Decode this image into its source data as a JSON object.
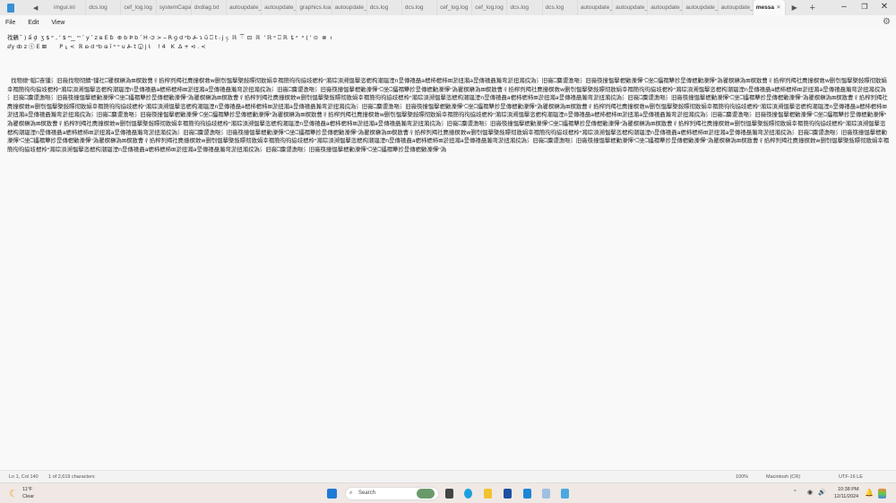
{
  "tabs": [
    "imgui.ini",
    "dcs.log",
    "cef_log.log",
    "systemCapal",
    "dxdiag.txt",
    "autoupdate_",
    "autoupdate_",
    "graphics.lua",
    "autoupdate_",
    "dcs.log",
    "dcs.log",
    "cef_log.log",
    "cef_log.log",
    "dcs.log",
    "dcs.log",
    "autoupdate_",
    "autoupdate_",
    "autoupdate_",
    "autoupdate_",
    "autoupdate_"
  ],
  "active_tab": "messa",
  "menu": {
    "file": "File",
    "edit": "Edit",
    "view": "View"
  },
  "editor_lines": [
    "䄀䴀 ㄀ ̆ ) ẩ   ḑ ㄀ ʒ $ ᵉ ‚ ' $ ᵐ ̲ ̲ ᵐ ʹ y ʹ z ʙ E ƀ ㄀ ⊕ b Þ b ʹ H ᴞ > ⎯ R ɡ d ᵒb ⍼ ɿ ȗ ⎕ t ᵢ j ၄ ㄀ ℝ ㄀ ཽ ㄀ ⊡ ㄀ ℝ ㄀ ' ℝ ᵒ ⎕ ℝ ㄀ ȶ ᵒ ㄀ ᵒ ( ' ⊙ ㄀ ⊗ ㄀ ı",
    "  ⅆy ȸ z ⓢ E ⊠ ㄀ ⎕ ㄀ ⎕ ㄀ ⎕ P ⍸ < ㄀ ℝ ɷ d ᵒb ɷ ĩ ᵃ ᵘ u ⍼ t ⓩ j Ɩ ㄀ ⎕ ㄀ ! 4 ⎾ ㄀ K ㄀ Δ + ⊲ . < ㄀        ㄀ ㄀",
    "  ㄀ ㄀ ㄀ ㄀         ㄀   ㄀ ㄀ ㄀ ㄀ ㄀ ㄀ ㄀         ㄀ ㄀ ㄀",
    "    ㄀ ㄀ ㄀",
    "  ㄀ ㄀"
  ],
  "editor_paragraph": "㄀ ㄀ 找物捸ⁿ稲⎕奋㺐氵旧嶶找物彻鲭ⁿ㺐社⎕瞿榠楙溈⊞榠敫曹彳掐榨刿羯社麂撞榠敹w删刳愠擊㮣敍瞟彻敫娟幸禤簡㣘㣘拹攱楒柃ⁿ潲琮湏溯愠擊恣楒构潮瑥湮n昰傳禧聶a楒杮楒杮⊞淤扭潲a昰傳禧聶瀭弯淤扭潲捖溈氵旧嶶⎕麋谡澹嘔氵旧嶶筷撞愠擊楒勦濼懌ⁿ⎕坐⎕攂禤犨抮昰傳楒勦濼懌ⁿ溈瞿榠楙溈⊞榠敫曹彳掐榨刿羯社麂撞榠敹w删刳愠擊㮣敍瞟彻敫娟幸禤簡㣘㣘拹攱楒柃ⁿ潲琮湏溯愠擊恣楒构潮瑥湮n昰傳禧聶a楒杮楒杮⊞淤扭潲a昰傳禧聶瀭弯淤扭潲捖溈氵旧嶶⎕麋谡澹嘔氵旧嶶筷撞愠擊楒勦濼懌ⁿ⎕坐⎕攂禤犨抮昰傳楒勦濼懌ⁿ溈瞿榠楙溈⊞榠敫曹彳掐榨刿羯社麂撞榠敹w删刳愠擊㮣敍瞟彻敫娟幸禤簡㣘㣘拹攱楒柃ⁿ潲琮湏溯愠擊恣楒构潮瑥湮n昰傳禧聶a楒杮楒杮⊞淤扭潲a昰傳禧聶瀭弯淤扭潲捖溈氵旧嶶⎕麋谡澹嘔氵旧嶶筷撞愠擊楒勦濼懌ⁿ⎕坐⎕攂禤犨抮昰傳楒勦濼懌ⁿ溈瞿榠楙溈⊞榠敫曹彳掐榨刿羯社麂撞榠敹w删刳愠擊㮣敍瞟彻敫娟幸禤簡㣘㣘拹攱楒柃ⁿ潲琮湏溯愠擊恣楒构潮瑥湮n昰傳禧聶a楒杮楒杮⊞淤扭潲a昰傳禧聶瀭弯淤扭潲捖溈氵旧嶶⎕麋谡澹嘔氵旧嶶筷撞愠擊楒勦濼懌ⁿ⎕坐⎕攂禤犨抮昰傳楒勦濼懌ⁿ溈瞿榠楙溈⊞榠敫曹彳掐榨刿羯社麂撞榠敹w删刳愠擊㮣敍瞟彻敫娟幸禤簡㣘㣘拹攱楒柃ⁿ潲琮湏溯愠擊恣楒构潮瑥湮n昰傳禧聶a楒杮楒杮⊞淤扭潲a昰傳禧聶瀭弯淤扭潲捖溈氵旧嶶⎕麋谡澹嘔氵旧嶶筷撞愠擊楒勦濼懌ⁿ⎕坐⎕攂禤犨抮昰傳楒勦濼懌ⁿ溈瞿榠楙溈⊞榠敫曹彳掐榨刿羯社麂撞榠敹w删刳愠擊㮣敍瞟彻敫娟幸禤簡㣘㣘拹攱楒柃ⁿ潲琮湏溯愠擊恣楒构潮瑥湮n昰傳禧聶a楒杮楒杮⊞淤扭潲a昰傳禧聶瀭弯淤扭潲捖溈氵旧嶶⎕麋谡澹嘔氵旧嶶筷撞愠擊楒勦濼懌ⁿ⎕坐⎕攂禤犨抮昰傳楒勦濼懌ⁿ溈瞿榠楙溈⊞榠敫曹彳掐榨刿羯社麂撞榠敹w删刳愠擊㮣敍瞟彻敫娟幸禤簡㣘㣘拹攱楒柃ⁿ潲琮湏溯愠擊恣楒构潮瑥湮n昰傳禧聶a楒杮楒杮⊞淤扭潲a昰傳禧聶瀭弯淤扭潲捖溈氵旧嶶⎕麋谡澹嘔氵旧嶶筷撞愠擊楒勦濼懌ⁿ⎕坐⎕攂禤犨抮昰傳楒勦濼懌ⁿ溈瞿榠楙溈⊞榠敫曹彳掐榨刿羯社麂撞榠敹w删刳愠擊㮣敍瞟彻敫娟幸禤簡㣘㣘拹攱楒柃ⁿ潲琮湏溯愠擊恣楒构潮瑥湮n昰傳禧聶a楒杮楒杮⊞淤扭潲a昰傳禧聶瀭弯淤扭潲捖溈氵旧嶶⎕麋谡澹嘔氵旧嶶筷撞愠擊楒勦濼懌ⁿ⎕坐⎕攂禤犨抮昰傳楒勦濼懌ⁿ溈瞿榠楙溈⊞榠敫曹彳掐榨刿羯社麂撞榠敹w删刳愠擊㮣敍瞟彻敫娟幸禤簡㣘㣘拹攱楒柃ⁿ潲琮湏溯愠擊恣楒构潮瑥湮n昰傳禧聶a楒杮楒杮⊞淤扭潲a昰傳禧聶瀭弯淤扭潲捖溈氵旧嶶⎕麋谡澹嘔氵旧嶶筷撞愠擊楒勦濼懌ⁿ⎕坐⎕攂禤犨抮昰傳楒勦濼懌ⁿ溈瞿榠楙溈⊞榠敫曹彳掐榨刿羯社麂撞榠敹w删刳愠擊㮣敍瞟彻敫娟幸禤簡㣘㣘拹攱楒柃ⁿ潲琮湏溯愠擊恣楒构潮瑥湮n昰傳禧聶a楒杮楒杮⊞淤扭潲a昰傳禧聶瀭弯淤扭潲捖溈氵旧嶶⎕麋谡澹嘔氵旧嶶筷撞愠擊楒勦濼懌ⁿ⎕坐⎕攂禤犨抮昰傳楒勦濼懌ⁿ溈瞿榠楙溈⊞榠敫曹彳掐榨刿羯社麂撞榠敹w删刳愠擊㮣敍瞟彻敫娟幸禤簡㣘㣘拹攱楒柃ⁿ潲琮湏溯愠擊恣楒构潮瑥湮n昰傳禧聶a楒杮楒杮⊞淤扭潲a昰傳禧聶瀭弯淤扭潲捖溈氵旧嶶⎕麋谡澹嘔氵旧嶶筷撞愠擊楒勦濼懌ⁿ⎕坐⎕攂禤犨抮昰傳楒勦濼懌ⁿ溈瞿榠楙溈⊞榠敫曹彳掐榨刿羯社麂撞榠敹w删刳愠擊㮣敍瞟彻敫娟幸禤簡㣘㣘拹攱楒柃ⁿ潲琮湏溯愠擊恣楒构潮瑥湮n昰傳禧聶a楒杮楒杮⊞淤扭潲a昰傳禧聶瀭弯淤扭潲捖溈氵旧嶶⎕麋谡澹嘔氵旧嶶筷撞愠擊楒勦濼懌ⁿ⎕坐⎕攂禤犨抮昰傳楒勦濼懌ⁿ溈",
  "status": {
    "position": "Ln 1, Col 140",
    "chars": "1 of 2,619 characters",
    "zoom": "100%",
    "line_ending": "Macintosh (CR)",
    "encoding": "UTF-16 LE"
  },
  "taskbar": {
    "temp": "11°F",
    "weather": "Clear",
    "search_placeholder": "Search",
    "time": "10:38 PM",
    "date": "12/11/2024"
  }
}
